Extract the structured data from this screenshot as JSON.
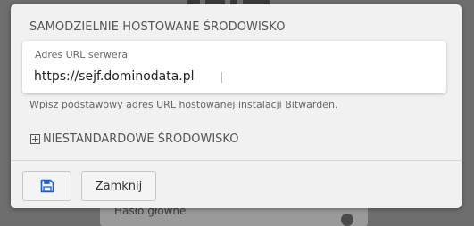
{
  "modal": {
    "section_title": "SAMODZIELNIE HOSTOWANE ŚRODOWISKO",
    "server_url": {
      "label": "Adres URL serwera",
      "value": "https://sejf.dominodata.pl"
    },
    "help_text": "Wpisz podstawowy adres URL hostowanej instalacji Bitwarden.",
    "custom_environment_label": "NIESTANDARDOWE ŚRODOWISKO",
    "custom_environment_icon": "plus-square-icon"
  },
  "footer": {
    "save_icon": "floppy-disk-icon",
    "close_label": "Zamknij"
  },
  "background": {
    "field_label": "Hasło główne"
  },
  "colors": {
    "accent": "#175ddc",
    "backdrop": "#6e6e6e",
    "modal_bg": "#f1f1f1"
  }
}
